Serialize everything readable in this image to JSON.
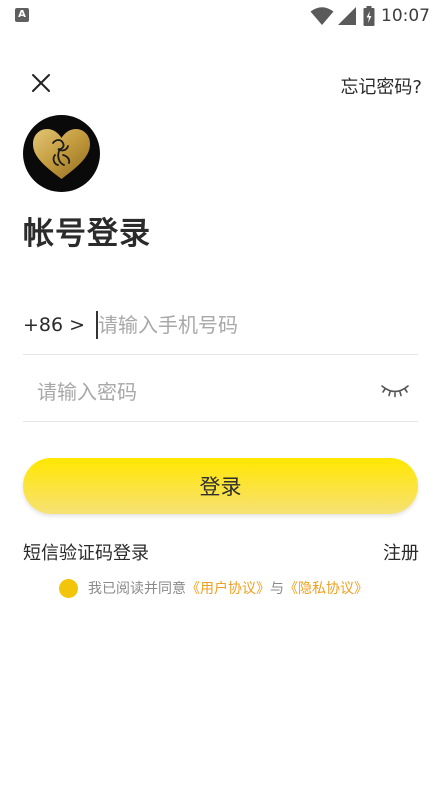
{
  "status_bar": {
    "app_icon_letter": "A",
    "time": "10:07",
    "icons": [
      "wifi-icon",
      "signal-icon",
      "battery-icon"
    ]
  },
  "header": {
    "close_icon": "close-icon",
    "forgot_password": "忘记密码?"
  },
  "logo": {
    "icon": "heart-logo-icon",
    "colors": {
      "background": "#0a0a0a",
      "heart": "#c9a44a"
    }
  },
  "title": "帐号登录",
  "phone": {
    "country_code": "+86 >",
    "placeholder": "请输入手机号码",
    "value": ""
  },
  "password": {
    "placeholder": "请输入密码",
    "value": "",
    "toggle_icon": "eye-closed-icon"
  },
  "login_button": "登录",
  "links": {
    "sms_login": "短信验证码登录",
    "register": "注册"
  },
  "agreement": {
    "checked": true,
    "prefix": "我已阅读并同意",
    "user_agreement": "《用户协议》",
    "connector": "与",
    "privacy_policy": "《隐私协议》"
  },
  "colors": {
    "accent_yellow": "#ffe700",
    "link_orange": "#f0a020",
    "checkbox_yellow": "#f2c40a"
  }
}
